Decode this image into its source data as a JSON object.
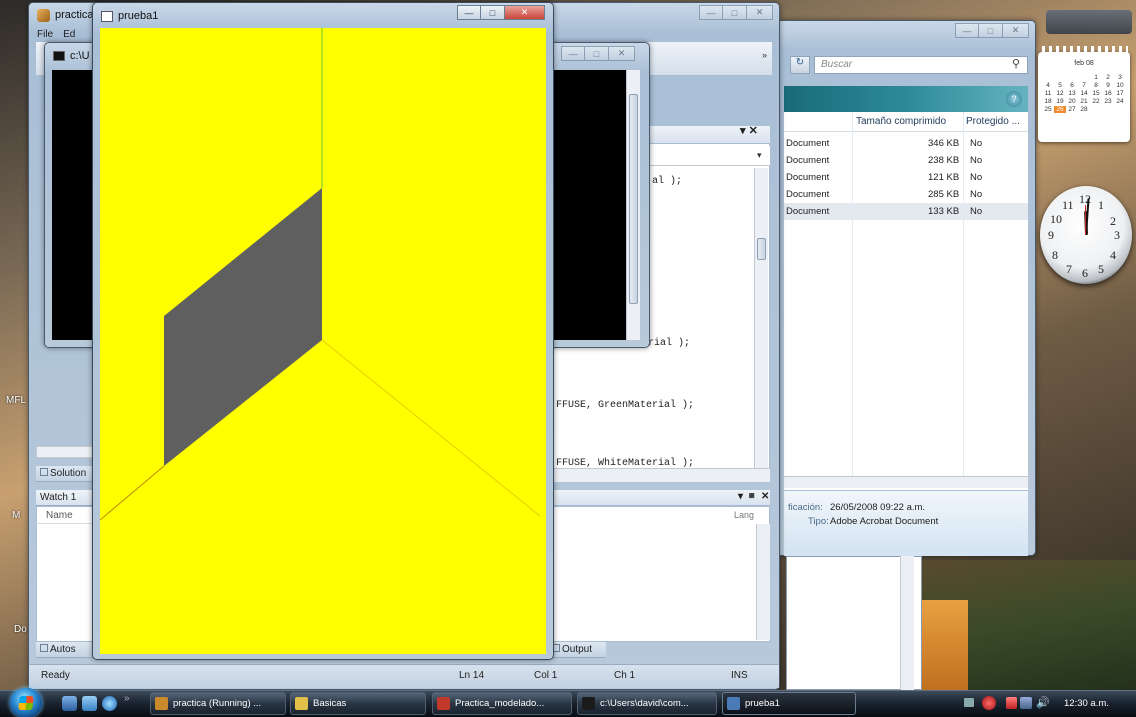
{
  "desktop": {
    "icon_labels": [
      "MFL",
      "M",
      "Do"
    ]
  },
  "vs_window": {
    "title": "practica",
    "menu": [
      "File",
      "Ed"
    ],
    "code_lines": [
      "al );",
      "terial );",
      "FFUSE, GreenMaterial );",
      "FFUSE, WhiteMaterial );"
    ],
    "panel_solution": "Solution",
    "watch": {
      "title": "Watch 1",
      "column_name": "Name",
      "column_lang": "Lang"
    },
    "tab_autos": "Autos",
    "tab_output": "Output",
    "status": {
      "left": "Ready",
      "line": "Ln 14",
      "col": "Col 1",
      "ch": "Ch 1",
      "mode": "INS"
    }
  },
  "explorer_window": {
    "search_placeholder": "Buscar",
    "columns": [
      "Tamaño comprimido",
      "Protegido ..."
    ],
    "rows": [
      {
        "type": "Document",
        "size": "346 KB",
        "protected": "No"
      },
      {
        "type": "Document",
        "size": "238 KB",
        "protected": "No"
      },
      {
        "type": "Document",
        "size": "121 KB",
        "protected": "No"
      },
      {
        "type": "Document",
        "size": "285 KB",
        "protected": "No"
      },
      {
        "type": "Document",
        "size": "133 KB",
        "protected": "No"
      }
    ],
    "details": {
      "date_label": "ficación:",
      "date_value": "26/05/2008 09:22 a.m.",
      "type_label": "Tipo:",
      "type_value": "Adobe Acrobat Document"
    }
  },
  "console_window": {
    "title": "c:\\U"
  },
  "prueba_window": {
    "title": "prueba1",
    "canvas_bg": "#ffff00",
    "shape_color": "#5f5f5f"
  },
  "gadgets": {
    "calendar": {
      "header": "feb 08",
      "days": [
        "",
        "",
        "",
        "",
        "1",
        "2",
        "3",
        "4",
        "5",
        "6",
        "7",
        "8",
        "9",
        "10",
        "11",
        "12",
        "13",
        "14",
        "15",
        "16",
        "17",
        "18",
        "19",
        "20",
        "21",
        "22",
        "23",
        "24",
        "25",
        "26",
        "27",
        "28",
        "",
        ""
      ],
      "today": "26"
    },
    "clock_numbers": [
      "12",
      "1",
      "2",
      "3",
      "4",
      "5",
      "6",
      "7",
      "8",
      "9",
      "10",
      "11"
    ]
  },
  "taskbar": {
    "buttons": [
      {
        "label": "practica (Running) ...",
        "icon_color": "#c98a2c"
      },
      {
        "label": "Basicas",
        "icon_color": "#e2c04a"
      },
      {
        "label": "Practica_modelado...",
        "icon_color": "#c0392b"
      },
      {
        "label": "c:\\Users\\david\\com...",
        "icon_color": "#1b1b1b"
      },
      {
        "label": "prueba1",
        "icon_color": "#4a7bb8"
      }
    ],
    "clock": "12:30 a.m."
  }
}
